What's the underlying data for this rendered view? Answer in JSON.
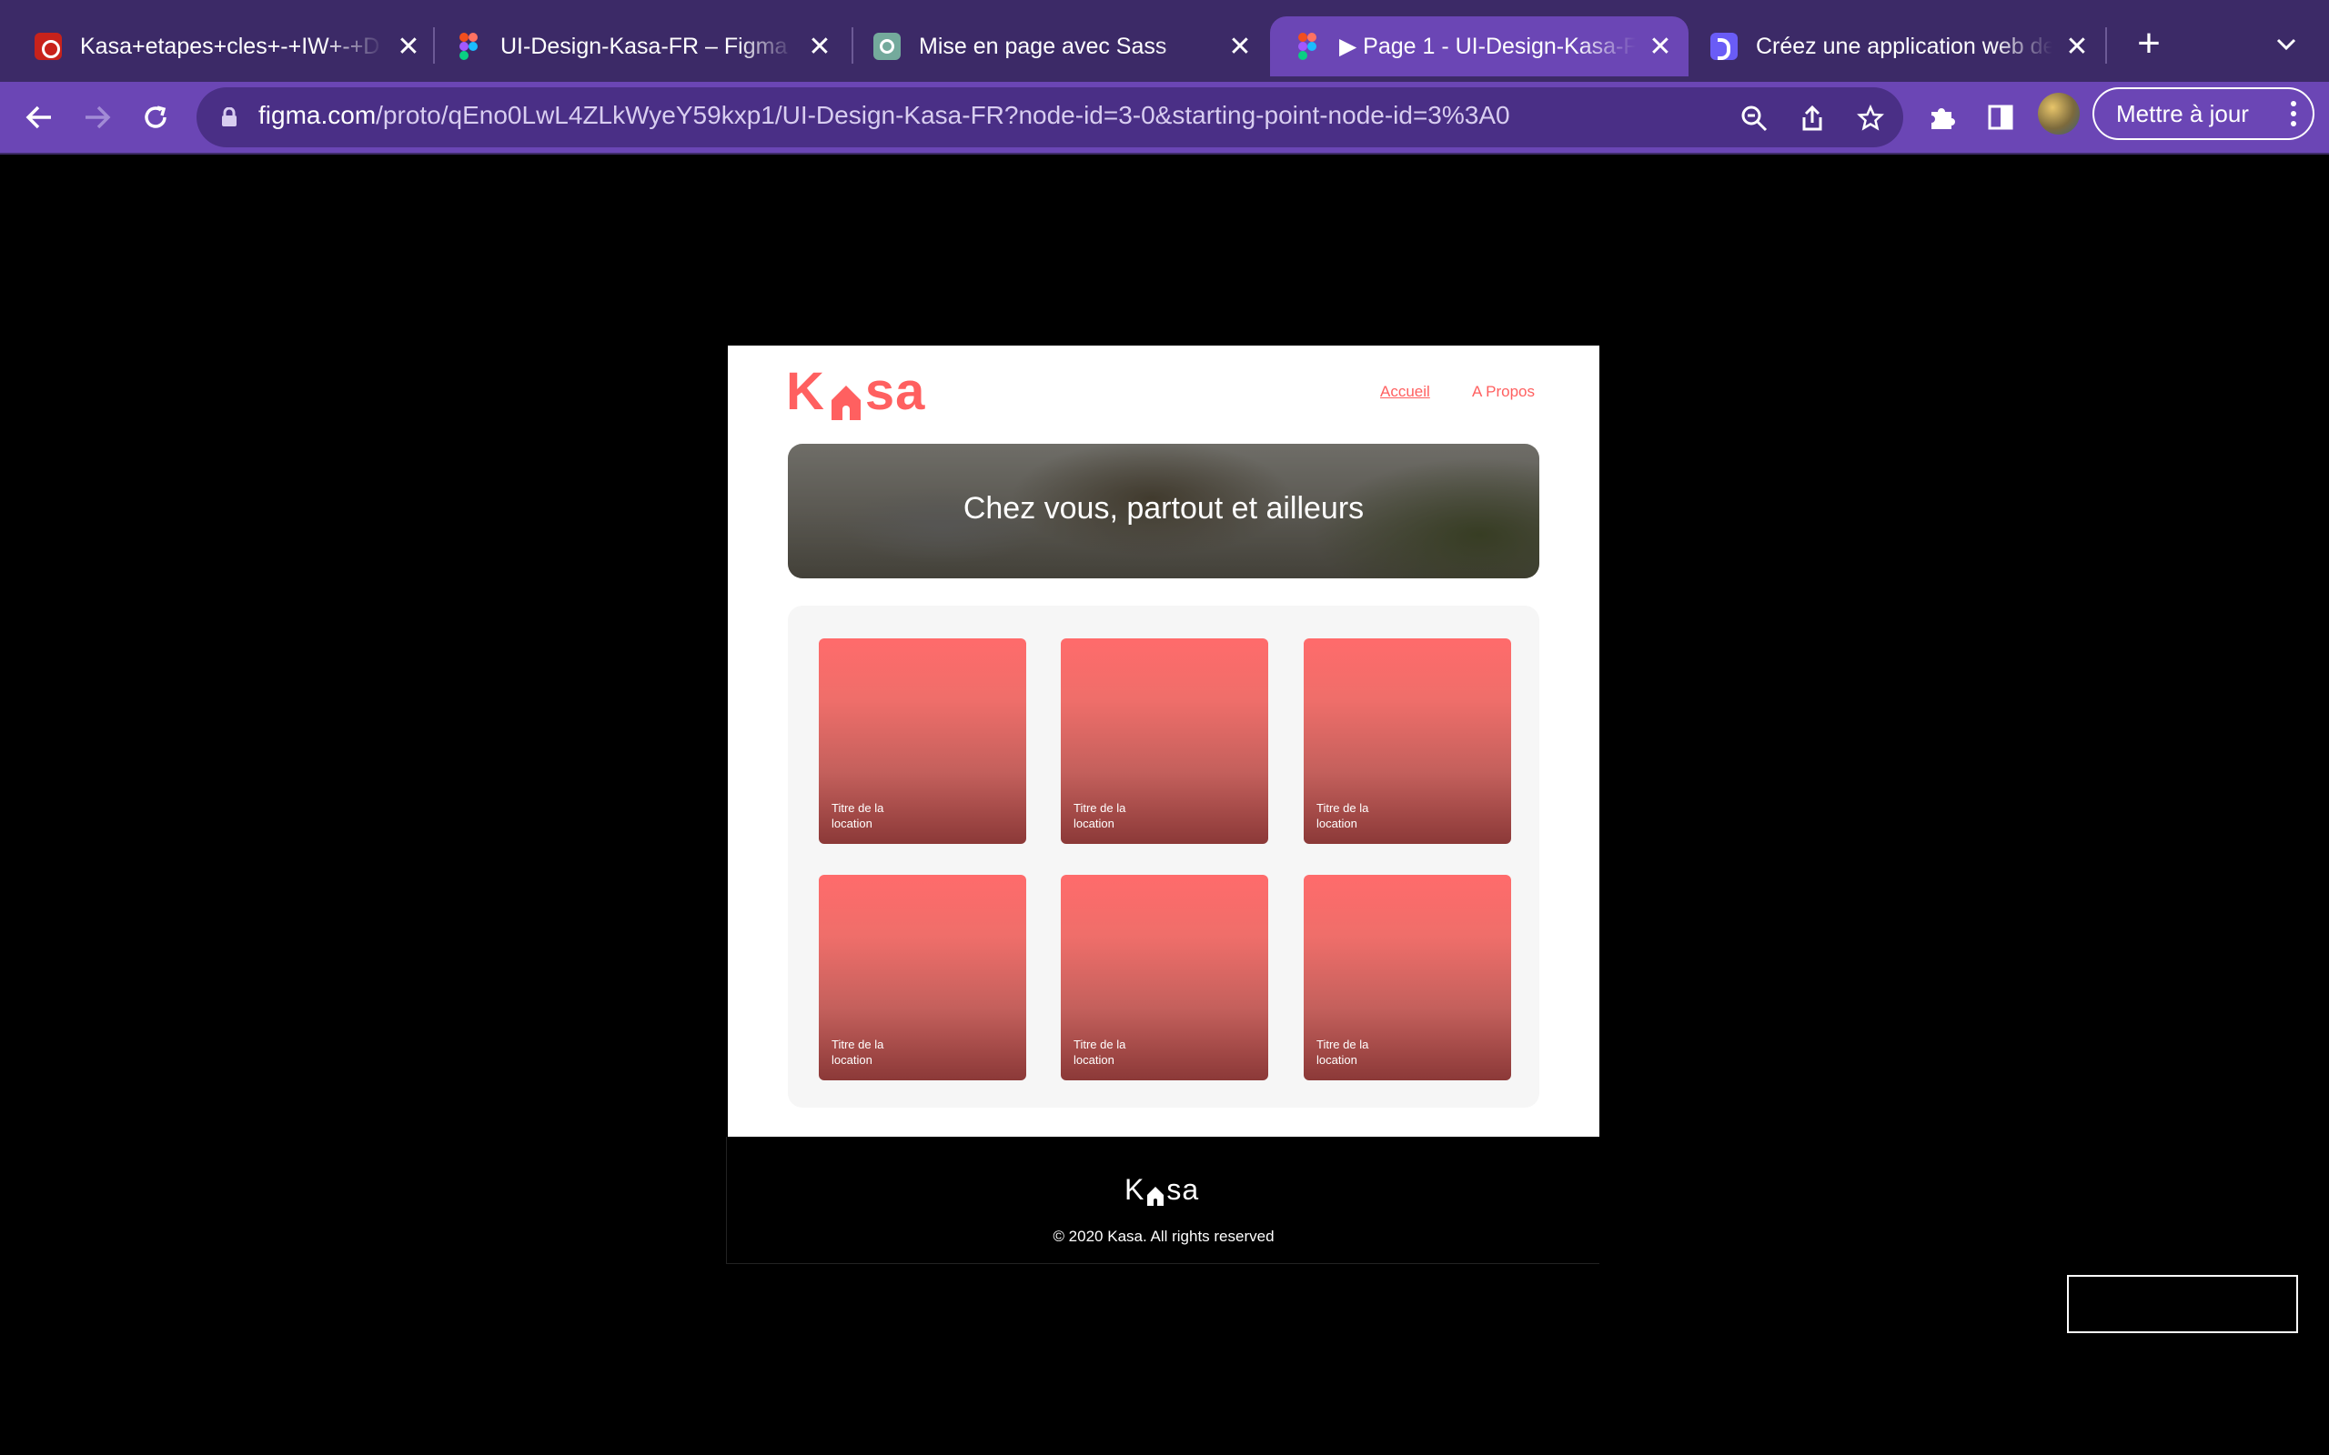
{
  "browser": {
    "tabs": [
      {
        "label": "Kasa+etapes+cles+-+IW+-+D",
        "icon": "pdf-icon",
        "active": false
      },
      {
        "label": "UI-Design-Kasa-FR – Figma",
        "icon": "figma-icon",
        "active": false
      },
      {
        "label": "Mise en page avec Sass",
        "icon": "chatgpt-icon",
        "active": false
      },
      {
        "label": "▶ Page 1 - UI-Design-Kasa-F",
        "icon": "figma-icon",
        "active": true
      },
      {
        "label": "Créez une application web de",
        "icon": "openclassrooms-icon",
        "active": false
      }
    ],
    "url_host": "figma.com",
    "url_path": "/proto/qEno0LwL4ZLkWyeY59kxp1/UI-Design-Kasa-FR?node-id=3-0&starting-point-node-id=3%3A0",
    "update_button": "Mettre à jour",
    "colors": {
      "tabbar": "#3c2a67",
      "toolbar": "#6b46b5"
    }
  },
  "page": {
    "logo_left": "K",
    "logo_right": "sa",
    "nav": {
      "home": "Accueil",
      "about": "A Propos"
    },
    "banner_title": "Chez vous, partout et ailleurs",
    "cards": [
      {
        "title": "Titre de la location"
      },
      {
        "title": "Titre de la location"
      },
      {
        "title": "Titre de la location"
      },
      {
        "title": "Titre de la location"
      },
      {
        "title": "Titre de la location"
      },
      {
        "title": "Titre de la location"
      }
    ],
    "footer_logo_left": "K",
    "footer_logo_right": "sa",
    "footer_copy": "© 2020 Kasa. All rights reserved",
    "colors": {
      "brand": "#ff6060",
      "gallery_bg": "#f6f6f6"
    }
  }
}
